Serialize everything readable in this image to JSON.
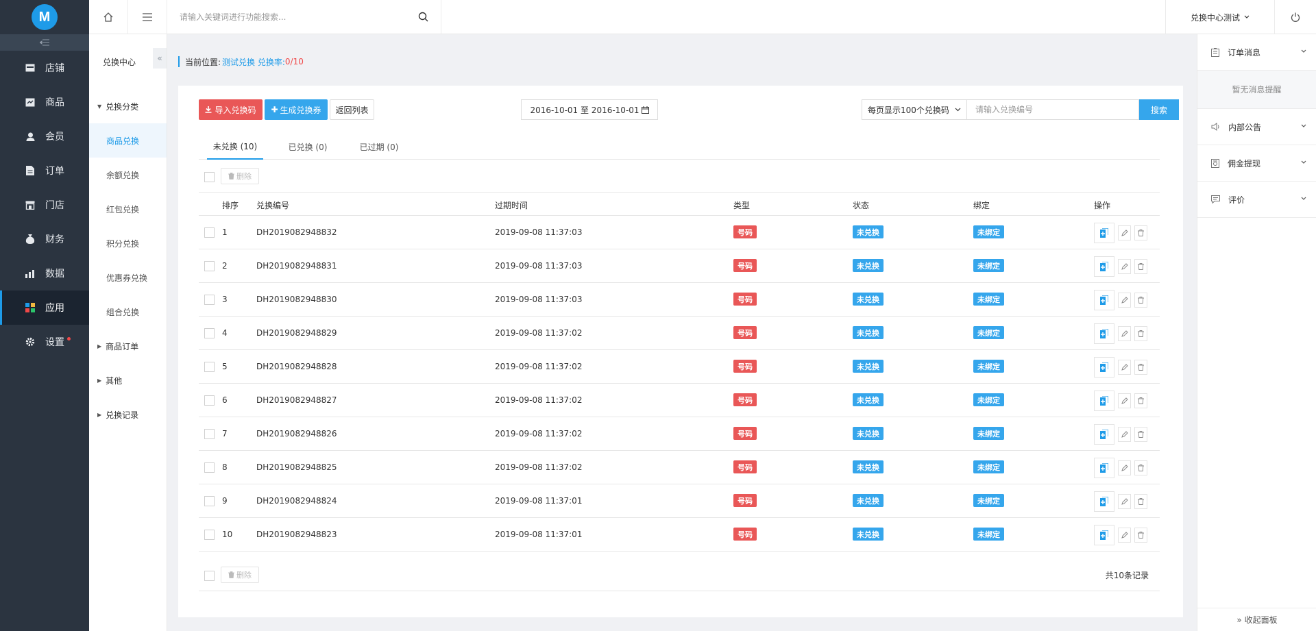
{
  "sidebar": {
    "logo_text": "M",
    "items": [
      {
        "label": "店铺",
        "icon": "shop-icon"
      },
      {
        "label": "商品",
        "icon": "goods-icon"
      },
      {
        "label": "会员",
        "icon": "member-icon"
      },
      {
        "label": "订单",
        "icon": "order-icon"
      },
      {
        "label": "门店",
        "icon": "store-icon"
      },
      {
        "label": "财务",
        "icon": "finance-icon"
      },
      {
        "label": "数据",
        "icon": "data-icon"
      },
      {
        "label": "应用",
        "icon": "app-icon",
        "active": true
      },
      {
        "label": "设置",
        "icon": "gear-icon"
      }
    ]
  },
  "subnav": {
    "title": "兑换中心",
    "group1": "兑换分类",
    "items": [
      "商品兑换",
      "余额兑换",
      "红包兑换",
      "积分兑换",
      "优惠券兑换",
      "组合兑换"
    ],
    "group2": "商品订单",
    "group3": "其他",
    "group4": "兑换记录"
  },
  "topbar": {
    "search_placeholder": "请输入关键词进行功能搜索...",
    "user": "兑换中心测试"
  },
  "breadcrumb": {
    "prefix": "当前位置:",
    "current": "测试兑换 兑换率:",
    "rate": "0/10"
  },
  "toolbar": {
    "import_label": "导入兑换码",
    "generate_label": "生成兑换券",
    "back_label": "返回列表",
    "date_range": "2016-10-01 至 2016-10-01",
    "per_page": "每页显示100个兑换码",
    "code_placeholder": "请输入兑换编号",
    "search_label": "搜索"
  },
  "tabs": [
    "未兑换 (10)",
    "已兑换 (0)",
    "已过期 (0)"
  ],
  "delete_label": "删除",
  "table": {
    "headers": [
      "排序",
      "兑换编号",
      "过期时间",
      "类型",
      "状态",
      "绑定",
      "操作"
    ],
    "rows": [
      {
        "idx": "1",
        "code": "DH2019082948832",
        "expire": "2019-09-08 11:37:03",
        "type": "号码",
        "status": "未兑换",
        "bind": "未绑定"
      },
      {
        "idx": "2",
        "code": "DH2019082948831",
        "expire": "2019-09-08 11:37:03",
        "type": "号码",
        "status": "未兑换",
        "bind": "未绑定"
      },
      {
        "idx": "3",
        "code": "DH2019082948830",
        "expire": "2019-09-08 11:37:03",
        "type": "号码",
        "status": "未兑换",
        "bind": "未绑定"
      },
      {
        "idx": "4",
        "code": "DH2019082948829",
        "expire": "2019-09-08 11:37:02",
        "type": "号码",
        "status": "未兑换",
        "bind": "未绑定"
      },
      {
        "idx": "5",
        "code": "DH2019082948828",
        "expire": "2019-09-08 11:37:02",
        "type": "号码",
        "status": "未兑换",
        "bind": "未绑定"
      },
      {
        "idx": "6",
        "code": "DH2019082948827",
        "expire": "2019-09-08 11:37:02",
        "type": "号码",
        "status": "未兑换",
        "bind": "未绑定"
      },
      {
        "idx": "7",
        "code": "DH2019082948826",
        "expire": "2019-09-08 11:37:02",
        "type": "号码",
        "status": "未兑换",
        "bind": "未绑定"
      },
      {
        "idx": "8",
        "code": "DH2019082948825",
        "expire": "2019-09-08 11:37:02",
        "type": "号码",
        "status": "未兑换",
        "bind": "未绑定"
      },
      {
        "idx": "9",
        "code": "DH2019082948824",
        "expire": "2019-09-08 11:37:01",
        "type": "号码",
        "status": "未兑换",
        "bind": "未绑定"
      },
      {
        "idx": "10",
        "code": "DH2019082948823",
        "expire": "2019-09-08 11:37:01",
        "type": "号码",
        "status": "未兑换",
        "bind": "未绑定"
      }
    ],
    "total": "共10条记录"
  },
  "rpanel": {
    "order_msg": "订单消息",
    "empty": "暂无消息提醒",
    "notice": "内部公告",
    "commission": "佣金提现",
    "review": "评价",
    "collapse": "» 收起面板"
  },
  "colors": {
    "accent": "#1e9be8",
    "danger": "#e95757",
    "sidebar": "#2b3440"
  }
}
